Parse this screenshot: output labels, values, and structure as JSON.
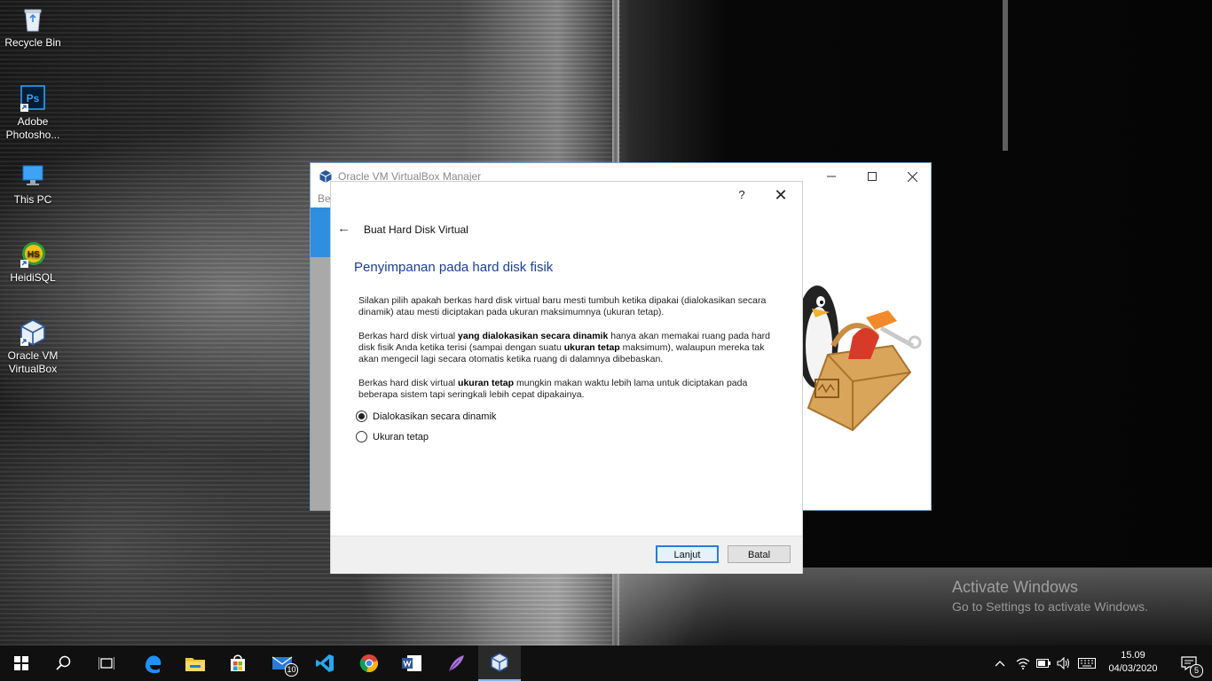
{
  "desktop": {
    "icons": [
      {
        "label": "Recycle Bin",
        "icon": "recycle-bin-icon"
      },
      {
        "label": "Adobe Photosho...",
        "icon": "photoshop-icon",
        "glyph": "Ps"
      },
      {
        "label": "This PC",
        "icon": "this-pc-icon"
      },
      {
        "label": "HeidiSQL",
        "icon": "heidisql-icon",
        "glyph": "HS"
      },
      {
        "label": "Oracle VM VirtualBox",
        "icon": "virtualbox-icon"
      }
    ]
  },
  "manager_window": {
    "title": "Oracle VM VirtualBox Manajer",
    "menu_fragment": "Ber"
  },
  "dialog": {
    "help_label": "?",
    "close_label": "✕",
    "back_label": "←",
    "title": "Buat Hard Disk Virtual",
    "heading": "Penyimpanan pada hard disk fisik",
    "para1": "Silakan pilih apakah berkas hard disk virtual baru mesti tumbuh ketika dipakai (dialokasikan secara dinamik) atau mesti diciptakan pada ukuran maksimumnya (ukuran tetap).",
    "para2": {
      "t1": "Berkas hard disk virtual ",
      "b1": "yang dialokasikan secara dinamik",
      "t2": " hanya akan memakai ruang pada hard disk fisik Anda ketika terisi (sampai dengan suatu ",
      "b2": "ukuran tetap",
      "t3": " maksimum), walaupun mereka tak akan mengecil lagi secara otomatis ketika ruang di dalamnya dibebaskan."
    },
    "para3": {
      "t1": "Berkas hard disk virtual ",
      "b1": "ukuran tetap",
      "t2": " mungkin makan waktu lebih lama untuk diciptakan pada beberapa sistem tapi seringkali lebih cepat dipakainya."
    },
    "options": [
      {
        "label": "Dialokasikan secara dinamik",
        "selected": true
      },
      {
        "label": "Ukuran tetap",
        "selected": false
      }
    ],
    "next_button": "Lanjut",
    "cancel_button": "Batal"
  },
  "watermark": {
    "line1": "Activate Windows",
    "line2": "Go to Settings to activate Windows."
  },
  "taskbar": {
    "mail_badge": "10",
    "notification_badge": "5",
    "time": "15.09",
    "date": "04/03/2020"
  },
  "colors": {
    "dialog_heading": "#1c3f94",
    "primary_button_border": "#2f7bd0",
    "manager_selection": "#2f8ede",
    "taskbar": "#101010"
  }
}
